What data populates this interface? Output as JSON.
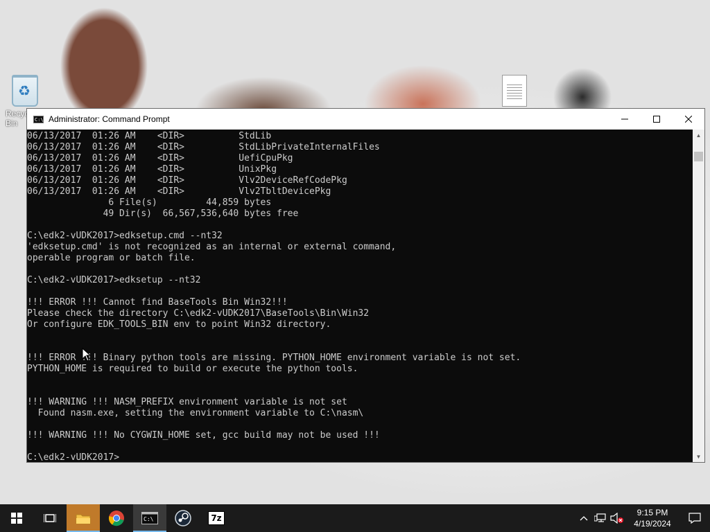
{
  "desktop": {
    "recycle_bin_label": "Recycle Bin"
  },
  "window": {
    "title": "Administrator: Command Prompt",
    "icon_text": "C:\\",
    "console_lines": [
      "06/13/2017  01:26 AM    <DIR>          StdLib",
      "06/13/2017  01:26 AM    <DIR>          StdLibPrivateInternalFiles",
      "06/13/2017  01:26 AM    <DIR>          UefiCpuPkg",
      "06/13/2017  01:26 AM    <DIR>          UnixPkg",
      "06/13/2017  01:26 AM    <DIR>          Vlv2DeviceRefCodePkg",
      "06/13/2017  01:26 AM    <DIR>          Vlv2TbltDevicePkg",
      "               6 File(s)         44,859 bytes",
      "              49 Dir(s)  66,567,536,640 bytes free",
      "",
      "C:\\edk2-vUDK2017>edksetup.cmd --nt32",
      "'edksetup.cmd' is not recognized as an internal or external command,",
      "operable program or batch file.",
      "",
      "C:\\edk2-vUDK2017>edksetup --nt32",
      "",
      "!!! ERROR !!! Cannot find BaseTools Bin Win32!!!",
      "Please check the directory C:\\edk2-vUDK2017\\BaseTools\\Bin\\Win32",
      "Or configure EDK_TOOLS_BIN env to point Win32 directory.",
      "",
      "",
      "!!! ERROR !!! Binary python tools are missing. PYTHON_HOME environment variable is not set.",
      "PYTHON_HOME is required to build or execute the python tools.",
      "",
      "",
      "!!! WARNING !!! NASM_PREFIX environment variable is not set",
      "  Found nasm.exe, setting the environment variable to C:\\nasm\\",
      "",
      "!!! WARNING !!! No CYGWIN_HOME set, gcc build may not be used !!!",
      "",
      "C:\\edk2-vUDK2017>"
    ]
  },
  "taskbar": {
    "apps": [
      {
        "name": "task-view-icon"
      },
      {
        "name": "file-explorer-icon"
      },
      {
        "name": "chrome-icon"
      },
      {
        "name": "command-prompt-icon"
      },
      {
        "name": "steam-icon"
      },
      {
        "name": "7zip-icon",
        "label": "7z"
      }
    ],
    "clock_time": "9:15 PM",
    "clock_date": "4/19/2024"
  },
  "colors": {
    "console_bg": "#0c0c0c",
    "console_fg": "#cccccc",
    "taskbar_bg": "#1b1b1b",
    "accent": "#76b9ed"
  }
}
